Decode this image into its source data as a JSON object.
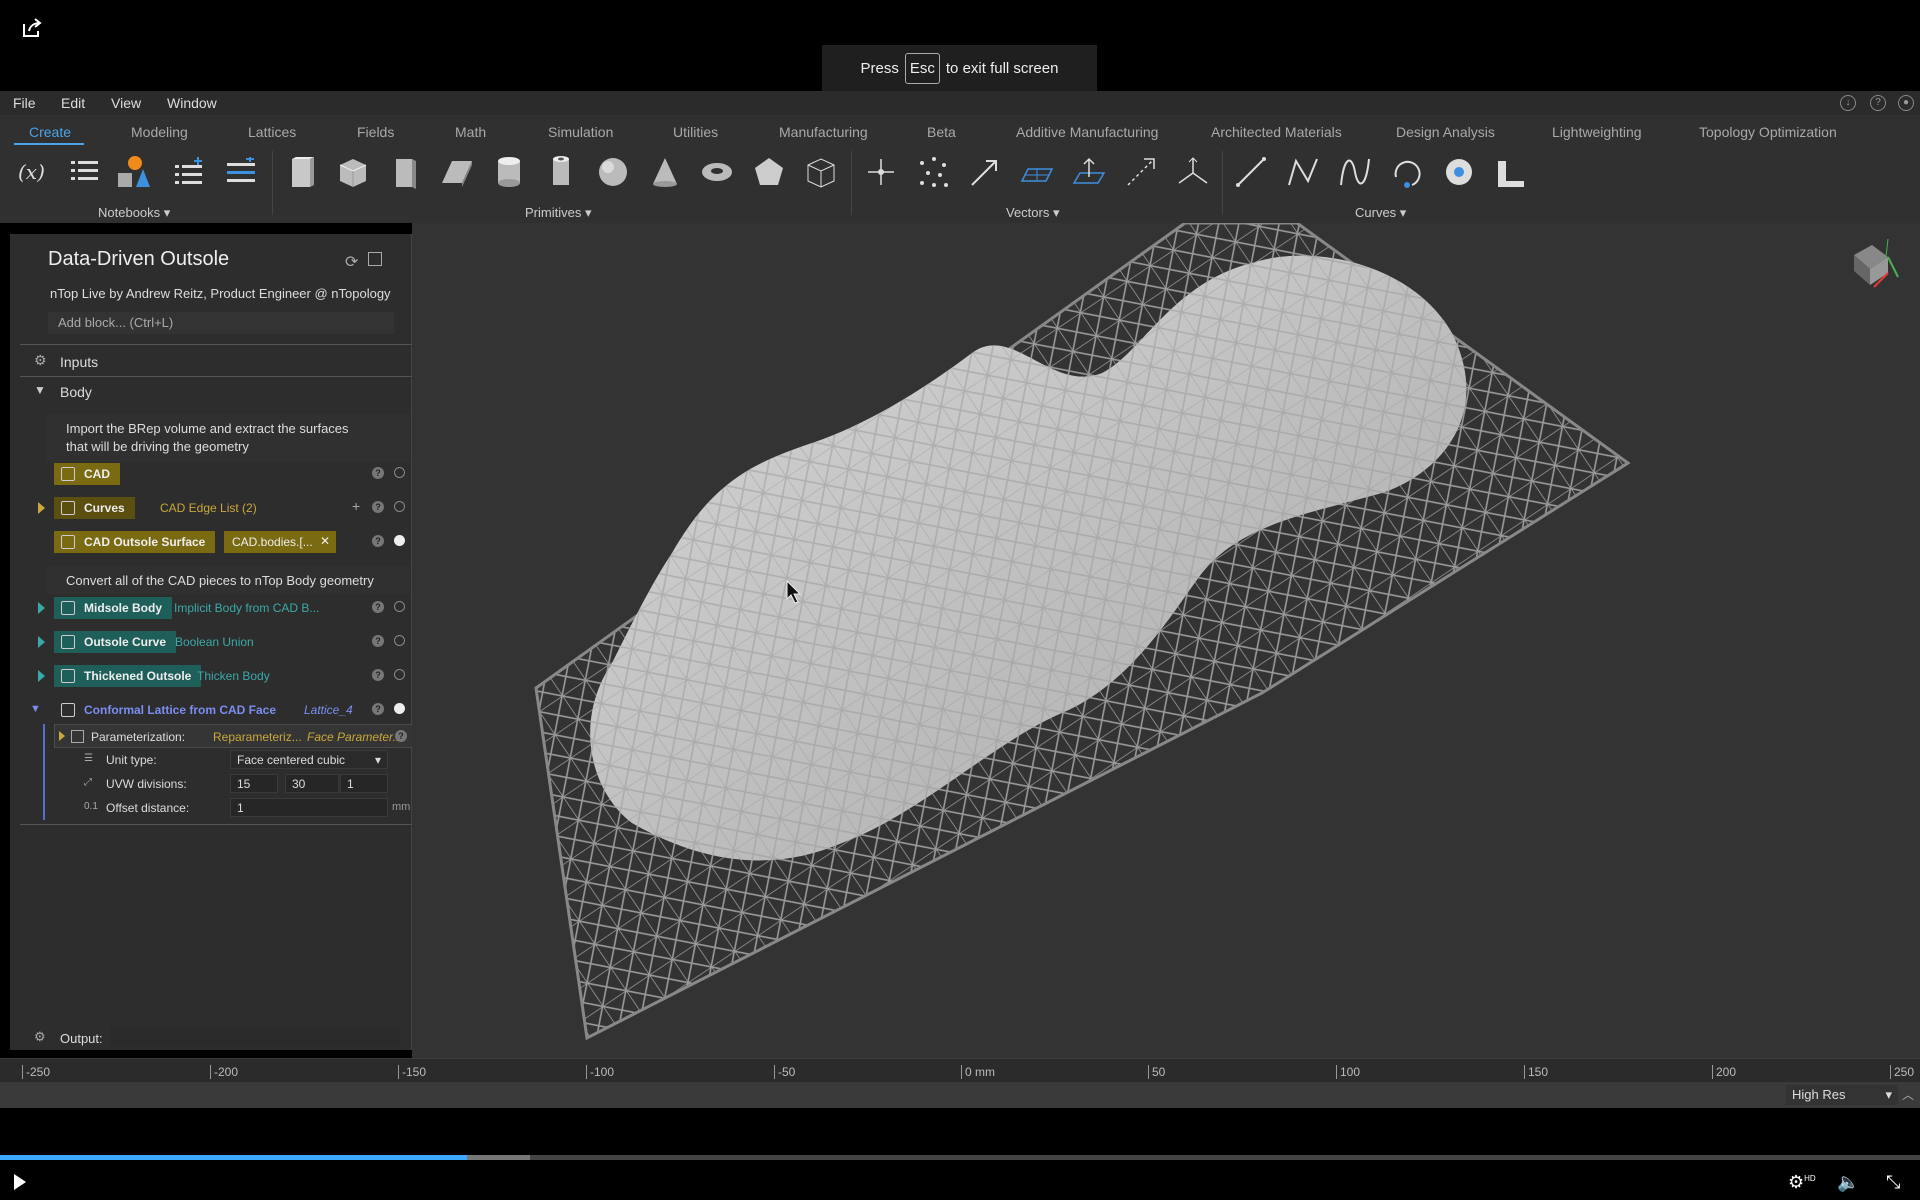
{
  "fullscreen_toast": {
    "prefix": "Press",
    "key": "Esc",
    "suffix": "to exit full screen"
  },
  "menu": [
    "File",
    "Edit",
    "View",
    "Window"
  ],
  "tabs": [
    "Create",
    "Modeling",
    "Lattices",
    "Fields",
    "Math",
    "Simulation",
    "Utilities",
    "Manufacturing",
    "Beta",
    "Additive Manufacturing",
    "Architected Materials",
    "Design Analysis",
    "Lightweighting",
    "Topology Optimization"
  ],
  "ribbon_groups": {
    "notebooks": "Notebooks",
    "primitives": "Primitives",
    "vectors": "Vectors",
    "curves": "Curves"
  },
  "notebook": {
    "title": "Data-Driven Outsole",
    "subtitle": "nTop Live by Andrew Reitz, Product Engineer @ nTopology",
    "add_block": "Add block... (Ctrl+L)",
    "inputs": "Inputs",
    "body": "Body",
    "output": "Output:",
    "comment1_line1": "Import the BRep volume and extract the surfaces",
    "comment1_line2": "that will be driving the geometry",
    "comment2": "Convert all of the CAD pieces to nTop Body geometry",
    "blocks": {
      "cad": {
        "name": "CAD"
      },
      "curves": {
        "name": "Curves",
        "value": "CAD Edge List (2)"
      },
      "cad_outsole": {
        "name": "CAD Outsole Surface",
        "value": "CAD.bodies.[..."
      },
      "midsole": {
        "name": "Midsole Body",
        "value": "Implicit Body from CAD B..."
      },
      "outsole_curve": {
        "name": "Outsole Curve",
        "value": "Boolean Union"
      },
      "thickened": {
        "name": "Thickened Outsole",
        "value": "Thicken Body"
      },
      "conformal": {
        "name": "Conformal Lattice from CAD Face",
        "value": "Lattice_4"
      }
    },
    "params": {
      "parameterization": {
        "label": "Parameterization:",
        "value": "Reparameteriz...",
        "type": "Face Parameter..."
      },
      "unit_type": {
        "label": "Unit type:",
        "value": "Face centered cubic"
      },
      "uvw": {
        "label": "UVW divisions:",
        "u": "15",
        "v": "30",
        "w": "1"
      },
      "offset": {
        "label": "Offset distance:",
        "value": "1",
        "unit": "mm"
      }
    }
  },
  "ruler_ticks": [
    "-250",
    "-200",
    "-150",
    "-100",
    "-50",
    "0 mm",
    "50",
    "100",
    "150",
    "200",
    "250"
  ],
  "resolution": "High Res",
  "video": {
    "progress_fraction": 0.243,
    "buffered_fraction": 0.276
  },
  "colors": {
    "accent": "#4aa3e8",
    "cad_tag": "#7a6a12",
    "body_tag": "#1f5f5a",
    "lattice_text": "#7b8ef0",
    "value_yellow": "#c9a83a",
    "value_teal": "#3aa9a9"
  }
}
